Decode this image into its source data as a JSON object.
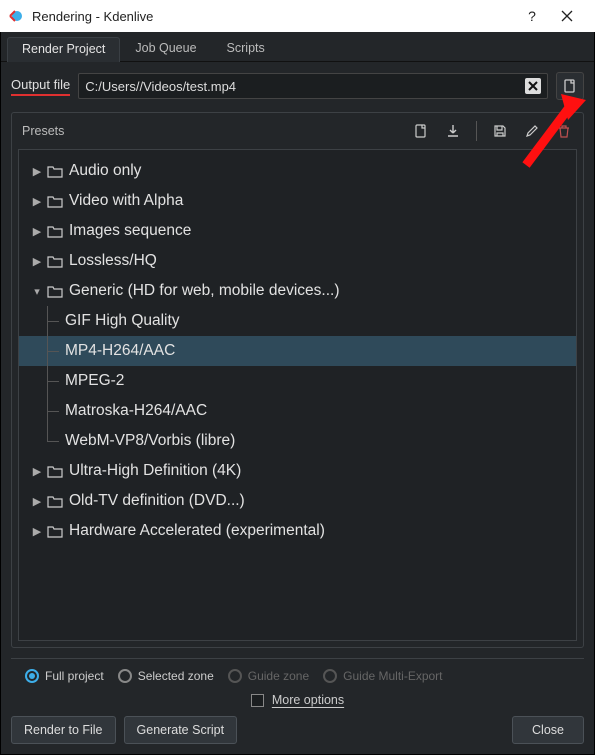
{
  "window": {
    "title": "Rendering - Kdenlive"
  },
  "tabs": {
    "render_project": "Render Project",
    "job_queue": "Job Queue",
    "scripts": "Scripts"
  },
  "output": {
    "label": "Output file",
    "path_prefix": "C:/Users/",
    "path_mid_hidden": "        ",
    "path_suffix": "/Videos/test.mp4"
  },
  "presets": {
    "title": "Presets",
    "categories": {
      "audio_only": "Audio only",
      "video_alpha": "Video with Alpha",
      "images_sequence": "Images sequence",
      "lossless": "Lossless/HQ",
      "generic": "Generic (HD for web, mobile devices...)",
      "uhd": "Ultra-High Definition (4K)",
      "oldtv": "Old-TV definition (DVD...)",
      "hwaccel": "Hardware Accelerated (experimental)"
    },
    "generic_children": {
      "gif": "GIF High Quality",
      "mp4": "MP4-H264/AAC",
      "mpeg2": "MPEG-2",
      "matroska": "Matroska-H264/AAC",
      "webm": "WebM-VP8/Vorbis (libre)"
    }
  },
  "options": {
    "full_project": "Full project",
    "selected_zone": "Selected zone",
    "guide_zone": "Guide zone",
    "guide_multi": "Guide Multi-Export",
    "more_options": "More options"
  },
  "buttons": {
    "render_to_file": "Render to File",
    "generate_script": "Generate Script",
    "close": "Close"
  }
}
